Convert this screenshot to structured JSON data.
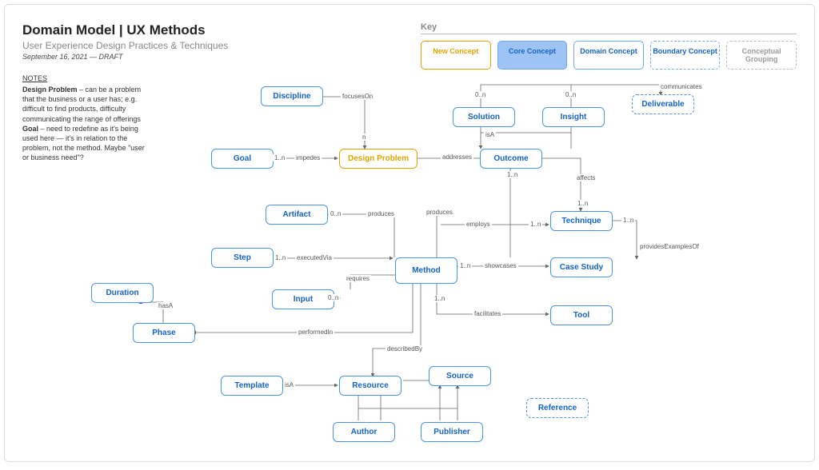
{
  "header": {
    "title": "Domain Model | UX Methods",
    "subtitle": "User Experience Design Practices & Techniques",
    "meta": "September 16, 2021 — DRAFT"
  },
  "notes": {
    "heading": "NOTES",
    "designProblemLabel": "Design Problem",
    "designProblemText": " – can be a problem that the business or a user has; e.g. difficult to find products, difficulty communicating the range of offerings",
    "goalLabel": "Goal",
    "goalText": " – need to redefine as it's being used here — it's in relation to the problem, not the method. Maybe \"user or business need\"?"
  },
  "key": {
    "label": "Key",
    "items": {
      "new": "New Concept",
      "core": "Core Concept",
      "domain": "Domain Concept",
      "boundary": "Boundary Concept",
      "group": "Conceptual Grouping"
    }
  },
  "nodes": {
    "discipline": "Discipline",
    "goal": "Goal",
    "designProblem": "Design Problem",
    "solution": "Solution",
    "insight": "Insight",
    "deliverable": "Deliverable",
    "outcome": "Outcome",
    "artifact": "Artifact",
    "technique": "Technique",
    "step": "Step",
    "method": "Method",
    "caseStudy": "Case Study",
    "duration": "Duration",
    "input": "Input",
    "tool": "Tool",
    "phase": "Phase",
    "template": "Template",
    "resource": "Resource",
    "source": "Source",
    "reference": "Reference",
    "author": "Author",
    "publisher": "Publisher"
  },
  "edges": {
    "focusesOn": "focusesOn",
    "impedes": "impedes",
    "addresses": "addresses",
    "isA": "isA",
    "communicates": "communicates",
    "affects": "affects",
    "produces": "produces",
    "employs": "employs",
    "providesExamplesOf": "providesExamplesOf",
    "executedVia": "executedVia",
    "showcases": "showcases",
    "requires": "requires",
    "hasA": "hasA",
    "facilitates": "facilitates",
    "performedIn": "performedIn",
    "describedBy": "describedBy",
    "n": "n",
    "zeroN": "0..n",
    "oneN": "1..n"
  }
}
